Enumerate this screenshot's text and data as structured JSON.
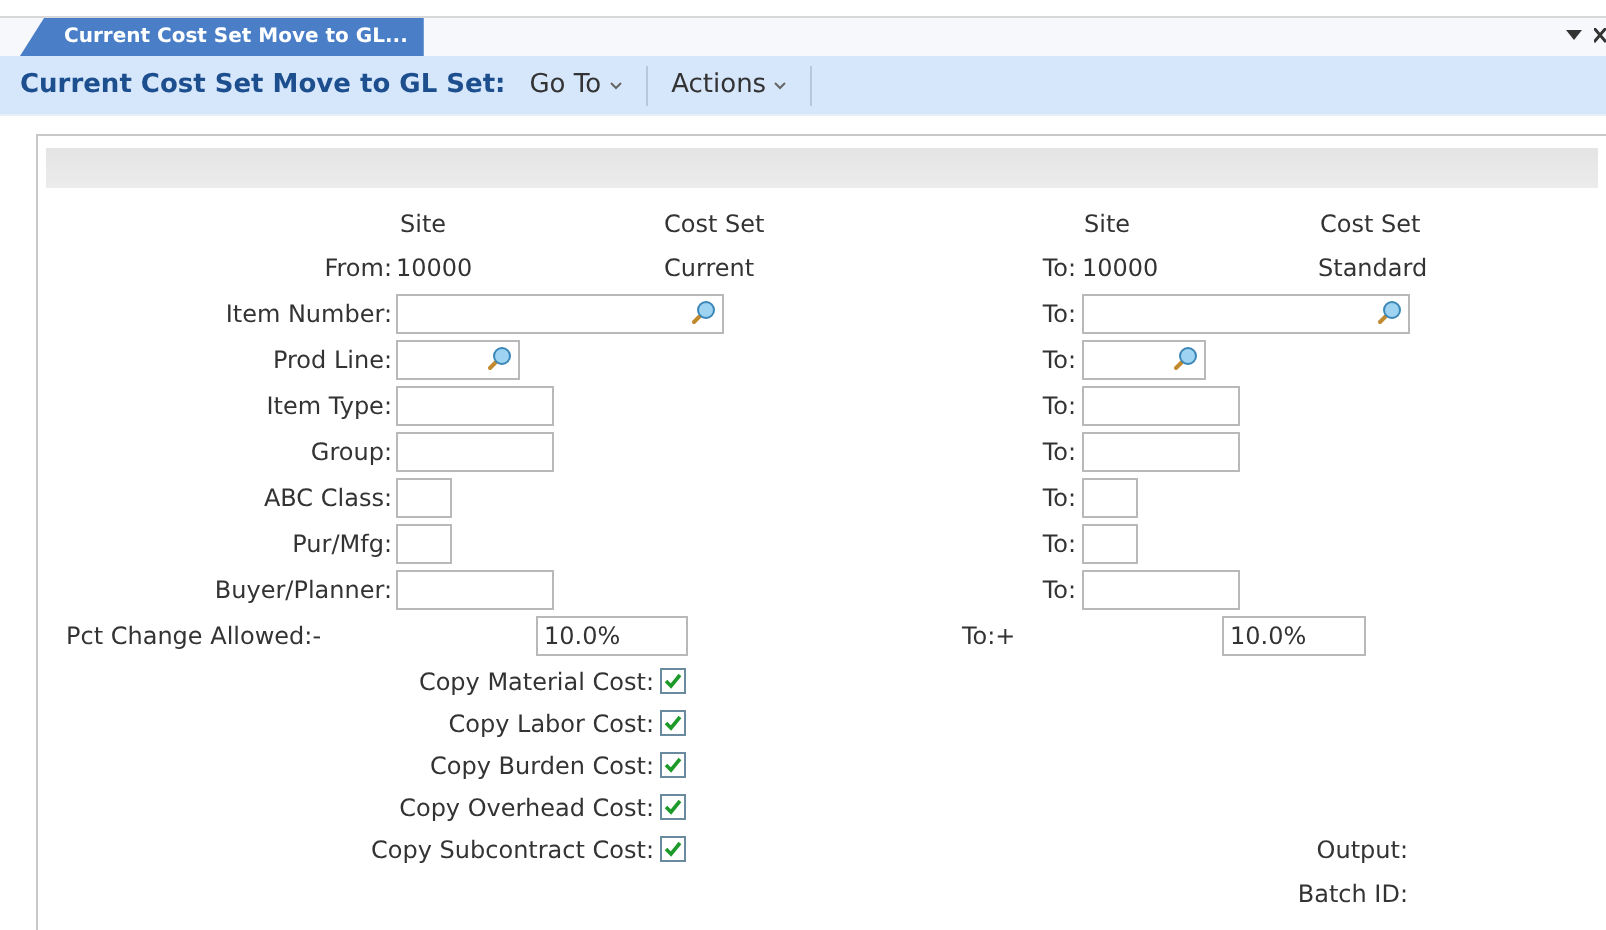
{
  "tab": {
    "label": "Current Cost Set Move to GL...",
    "selected": true
  },
  "toolbar": {
    "title": "Current Cost Set Move to GL Set:",
    "menus": [
      "Go To",
      "Actions"
    ]
  },
  "columns": {
    "left": [
      "Site",
      "Cost Set"
    ],
    "right": [
      "Site",
      "Cost Set"
    ]
  },
  "range_header": {
    "from_label": "From:",
    "from_site": "10000",
    "from_cost_set": "Current",
    "to_label": "To:",
    "to_site": "10000",
    "to_cost_set": "Standard"
  },
  "fields": [
    {
      "label": "Item Number:",
      "kind": "search-wide",
      "to_label": "To:"
    },
    {
      "label": "Prod Line:",
      "kind": "search-narrow",
      "to_label": "To:"
    },
    {
      "label": "Item Type:",
      "kind": "text",
      "to_label": "To:"
    },
    {
      "label": "Group:",
      "kind": "text",
      "to_label": "To:"
    },
    {
      "label": "ABC Class:",
      "kind": "code",
      "to_label": "To:"
    },
    {
      "label": "Pur/Mfg:",
      "kind": "code",
      "to_label": "To:"
    },
    {
      "label": "Buyer/Planner:",
      "kind": "text",
      "to_label": "To:"
    }
  ],
  "pct_change": {
    "label": "Pct Change Allowed:-",
    "value": "10.0%",
    "to_label": "To:+",
    "to_value": "10.0%"
  },
  "options": [
    {
      "label": "Copy Material Cost:",
      "checked": true
    },
    {
      "label": "Copy Labor Cost:",
      "checked": true
    },
    {
      "label": "Copy Burden Cost:",
      "checked": true
    },
    {
      "label": "Copy Overhead Cost:",
      "checked": true
    },
    {
      "label": "Copy Subcontract Cost:",
      "checked": true
    }
  ],
  "output_fields": [
    "Output:",
    "Batch ID:"
  ]
}
